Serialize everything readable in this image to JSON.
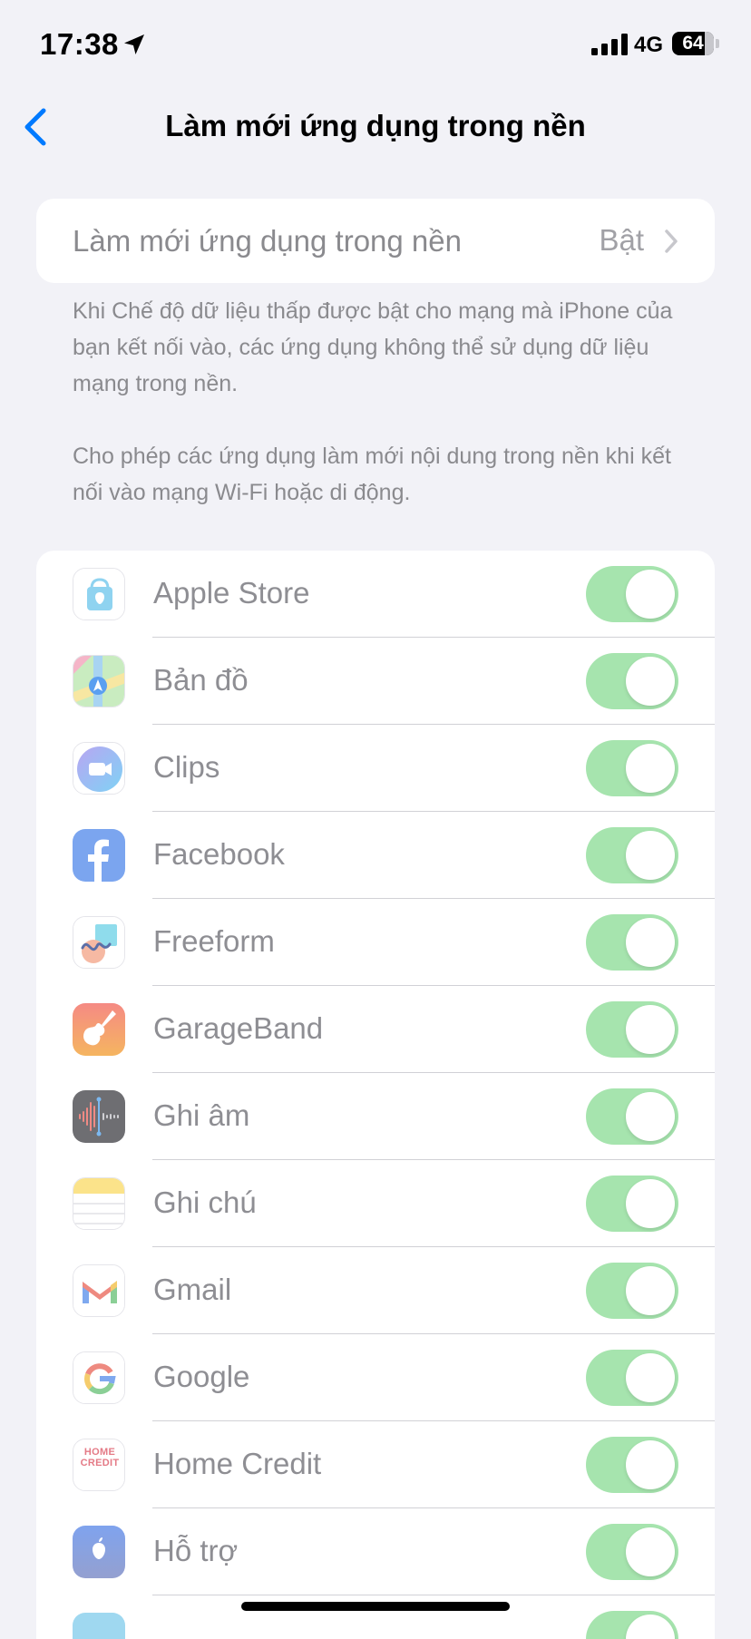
{
  "status_bar": {
    "time": "17:38",
    "network": "4G",
    "battery_percent": "64",
    "battery_level": 0.64
  },
  "nav": {
    "back_icon": "chevron-left-icon",
    "title": "Làm mới ứng dụng trong nền"
  },
  "main_setting": {
    "label": "Làm mới ứng dụng trong nền",
    "value": "Bật"
  },
  "footers": [
    "Khi Chế độ dữ liệu thấp được bật cho mạng mà iPhone của bạn kết nối vào, các ứng dụng không thể sử dụng dữ liệu mạng trong nền.",
    "Cho phép các ứng dụng làm mới nội dung trong nền khi kết nối vào mạng Wi-Fi hoặc di động."
  ],
  "colors": {
    "accent": "#007aff",
    "toggle_on": "#a6e4ae",
    "background": "#f2f2f7"
  },
  "apps": [
    {
      "name": "Apple Store",
      "icon": "apple-store-icon",
      "enabled": true
    },
    {
      "name": "Bản đồ",
      "icon": "maps-icon",
      "enabled": true
    },
    {
      "name": "Clips",
      "icon": "clips-icon",
      "enabled": true
    },
    {
      "name": "Facebook",
      "icon": "facebook-icon",
      "enabled": true
    },
    {
      "name": "Freeform",
      "icon": "freeform-icon",
      "enabled": true
    },
    {
      "name": "GarageBand",
      "icon": "garageband-icon",
      "enabled": true
    },
    {
      "name": "Ghi âm",
      "icon": "voice-memos-icon",
      "enabled": true
    },
    {
      "name": "Ghi chú",
      "icon": "notes-icon",
      "enabled": true
    },
    {
      "name": "Gmail",
      "icon": "gmail-icon",
      "enabled": true
    },
    {
      "name": "Google",
      "icon": "google-icon",
      "enabled": true
    },
    {
      "name": "Home Credit",
      "icon": "home-credit-icon",
      "enabled": true,
      "icon_text": "HOME CREDIT"
    },
    {
      "name": "Hỗ trợ",
      "icon": "apple-support-icon",
      "enabled": true
    },
    {
      "name": "",
      "icon": "app-icon",
      "enabled": true
    }
  ]
}
